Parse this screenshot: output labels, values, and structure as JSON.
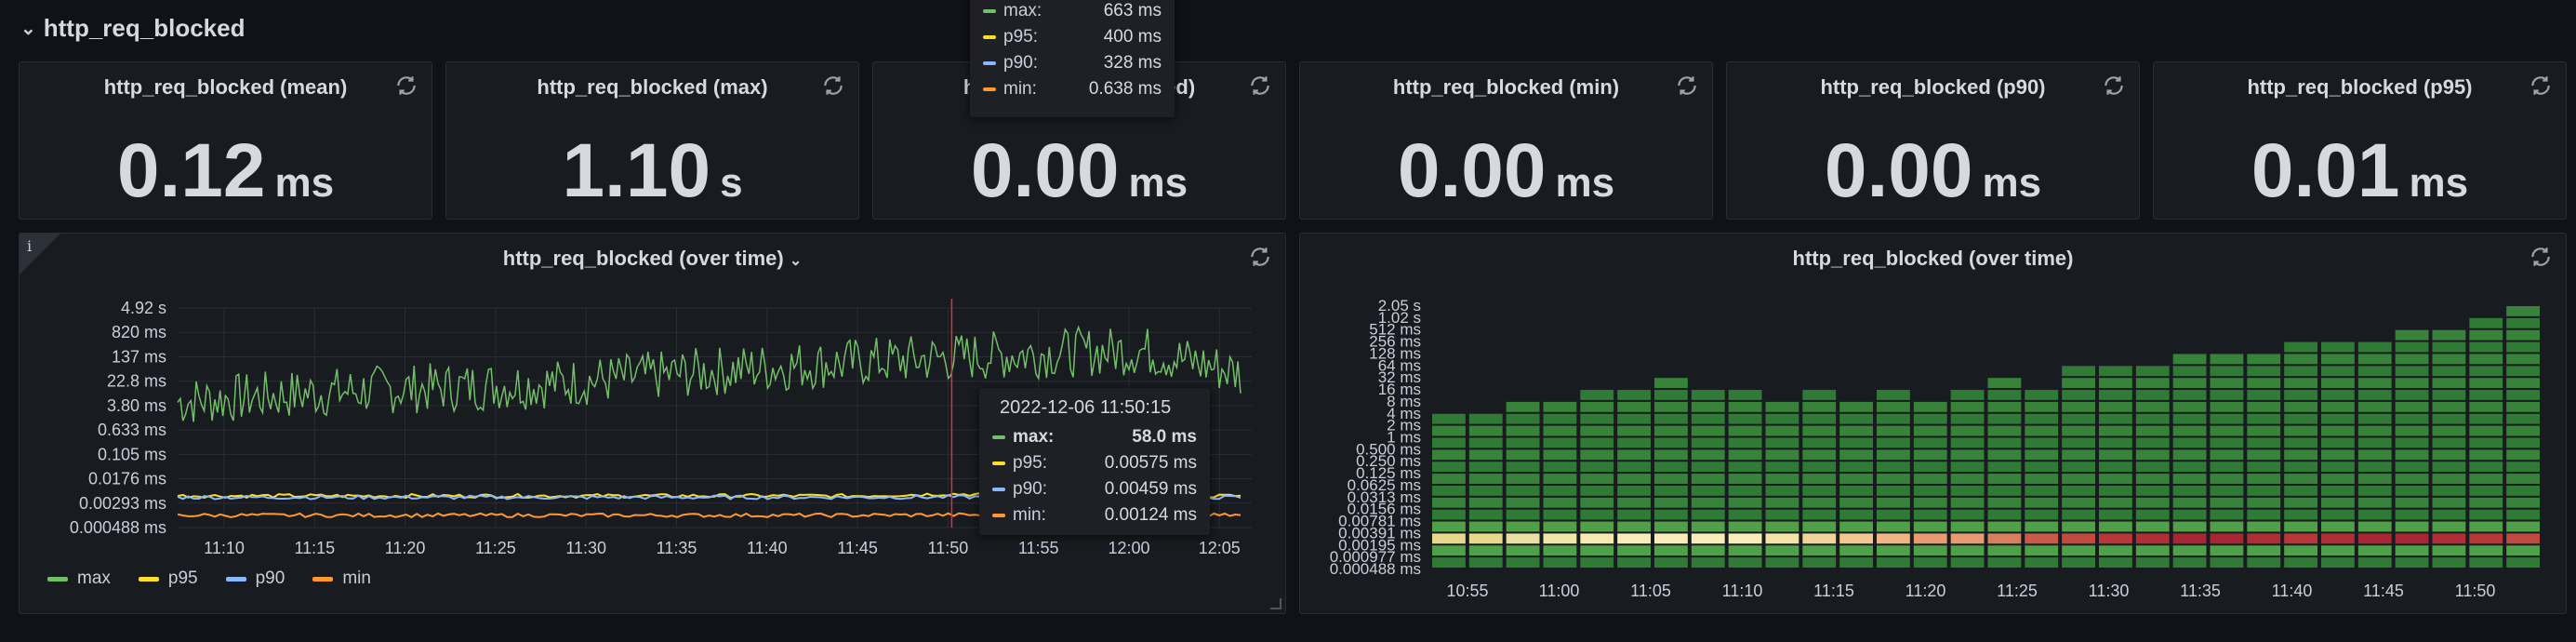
{
  "row": {
    "title": "http_req_blocked"
  },
  "stats": [
    {
      "title": "http_req_blocked (mean)",
      "value": "0.12",
      "unit": "ms"
    },
    {
      "title": "http_req_blocked (max)",
      "value": "1.10",
      "unit": "s"
    },
    {
      "title": "http_req_blocked (med)",
      "value": "0.00",
      "unit": "ms"
    },
    {
      "title": "http_req_blocked (min)",
      "value": "0.00",
      "unit": "ms"
    },
    {
      "title": "http_req_blocked (p90)",
      "value": "0.00",
      "unit": "ms"
    },
    {
      "title": "http_req_blocked (p95)",
      "value": "0.01",
      "unit": "ms"
    }
  ],
  "timeseries": {
    "title": "http_req_blocked (over time)",
    "legend": [
      {
        "name": "max",
        "color": "#73bf69"
      },
      {
        "name": "p95",
        "color": "#fade2a"
      },
      {
        "name": "p90",
        "color": "#8ab8ff"
      },
      {
        "name": "min",
        "color": "#ff9830"
      }
    ],
    "tooltip": {
      "time": "2022-12-06 11:50:15",
      "rows": [
        {
          "name": "max:",
          "value": "58.0 ms",
          "color": "#73bf69"
        },
        {
          "name": "p95:",
          "value": "0.00575 ms",
          "color": "#fade2a"
        },
        {
          "name": "p90:",
          "value": "0.00459 ms",
          "color": "#8ab8ff"
        },
        {
          "name": "min:",
          "value": "0.00124 ms",
          "color": "#ff9830"
        }
      ]
    }
  },
  "top_tooltip": {
    "rows": [
      {
        "name": "max:",
        "value": "663 ms",
        "color": "#73bf69"
      },
      {
        "name": "p95:",
        "value": "400 ms",
        "color": "#fade2a"
      },
      {
        "name": "p90:",
        "value": "328 ms",
        "color": "#8ab8ff"
      },
      {
        "name": "min:",
        "value": "0.638 ms",
        "color": "#ff9830"
      }
    ]
  },
  "heatmap": {
    "title": "http_req_blocked (over time)"
  },
  "chart_data": [
    {
      "type": "line",
      "title": "http_req_blocked (over time)",
      "y_scale": "log",
      "y_ticks": [
        "4.92 s",
        "820 ms",
        "137 ms",
        "22.8 ms",
        "3.80 ms",
        "0.633 ms",
        "0.105 ms",
        "0.0176 ms",
        "0.00293 ms",
        "0.000488 ms"
      ],
      "x_ticks": [
        "11:10",
        "11:15",
        "11:20",
        "11:25",
        "11:30",
        "11:35",
        "11:40",
        "11:45",
        "11:50",
        "11:55",
        "12:00",
        "12:05"
      ],
      "series": [
        {
          "name": "max",
          "values_ms": [
            5,
            8,
            12,
            15,
            20,
            35,
            60,
            90,
            130,
            180,
            220,
            40
          ]
        },
        {
          "name": "p95",
          "values_ms": [
            0.005,
            0.005,
            0.005,
            0.005,
            0.005,
            0.005,
            0.005,
            0.005,
            0.00575,
            0.005,
            0.005,
            0.005
          ]
        },
        {
          "name": "p90",
          "values_ms": [
            0.0045,
            0.0045,
            0.0045,
            0.0045,
            0.0045,
            0.0045,
            0.0045,
            0.0045,
            0.00459,
            0.0045,
            0.0045,
            0.0045
          ]
        },
        {
          "name": "min",
          "values_ms": [
            0.0012,
            0.0012,
            0.0012,
            0.0012,
            0.0012,
            0.0012,
            0.0012,
            0.0012,
            0.00124,
            0.0012,
            0.0012,
            0.0012
          ]
        }
      ],
      "grid": true,
      "legend": "bottom-left"
    },
    {
      "type": "heatmap",
      "title": "http_req_blocked (over time)",
      "y_ticks": [
        "2.05 s",
        "1.02 s",
        "512 ms",
        "256 ms",
        "128 ms",
        "64 ms",
        "32 ms",
        "16 ms",
        "8 ms",
        "4 ms",
        "2 ms",
        "1 ms",
        "0.500 ms",
        "0.250 ms",
        "0.125 ms",
        "0.0625 ms",
        "0.0313 ms",
        "0.0156 ms",
        "0.00781 ms",
        "0.00391 ms",
        "0.00195 ms",
        "0.000977 ms",
        "0.000488 ms"
      ],
      "x_ticks": [
        "10:55",
        "11:00",
        "11:05",
        "11:10",
        "11:15",
        "11:20",
        "11:25",
        "11:30",
        "11:35",
        "11:40",
        "11:45",
        "11:50"
      ],
      "column_top_bucket": [
        13,
        13,
        14,
        14,
        15,
        15,
        16,
        15,
        15,
        14,
        15,
        14,
        15,
        14,
        15,
        16,
        15,
        17,
        17,
        17,
        18,
        18,
        18,
        19,
        19,
        19,
        20,
        20,
        21,
        22
      ],
      "hot_bucket": 2
    }
  ]
}
